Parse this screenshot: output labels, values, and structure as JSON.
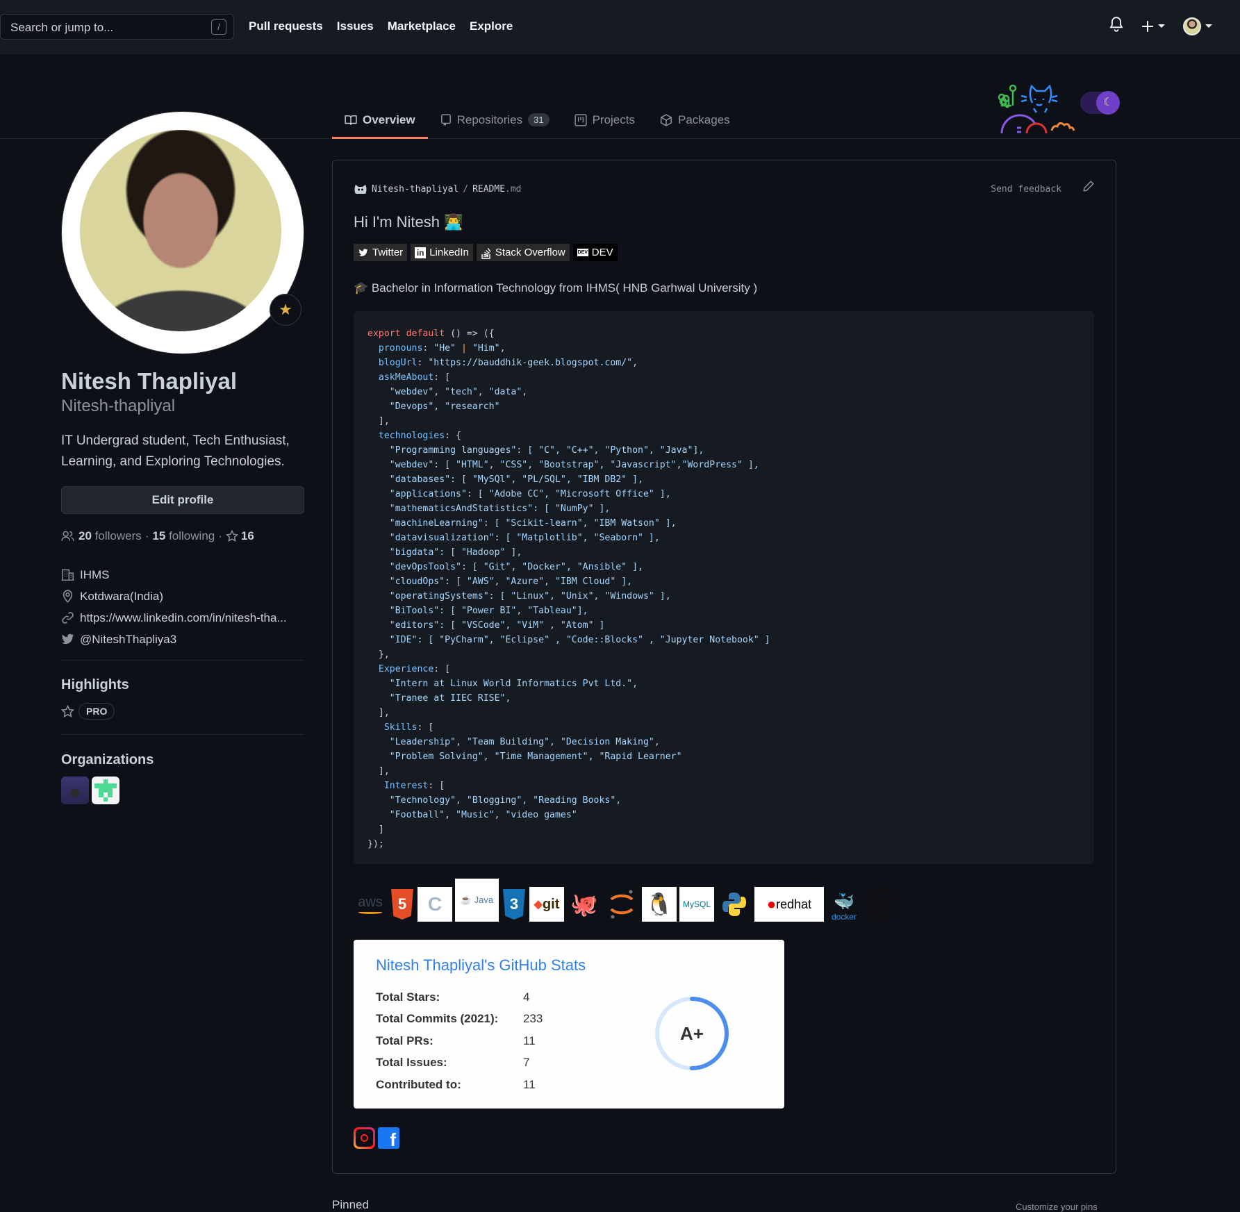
{
  "header": {
    "search_placeholder": "Search or jump to...",
    "search_shortcut": "/",
    "nav": [
      "Pull requests",
      "Issues",
      "Marketplace",
      "Explore"
    ],
    "icons": [
      "bell-icon",
      "plus-icon",
      "avatar"
    ]
  },
  "tabs": [
    {
      "label": "Overview",
      "icon": "book-icon",
      "active": true
    },
    {
      "label": "Repositories",
      "icon": "repo-icon",
      "count": "31"
    },
    {
      "label": "Projects",
      "icon": "project-icon"
    },
    {
      "label": "Packages",
      "icon": "package-icon"
    }
  ],
  "profile": {
    "name": "Nitesh Thapliyal",
    "login": "Nitesh-thapliyal",
    "bio": "IT Undergrad student, Tech Enthusiast, Learning, and Exploring Technologies.",
    "edit_label": "Edit profile",
    "followers": "20",
    "followers_label": "followers",
    "following": "15",
    "following_label": "following",
    "stars": "16",
    "company": "IHMS",
    "location": "Kotdwara(India)",
    "website": "https://www.linkedin.com/in/nitesh-tha...",
    "twitter": "@NiteshThapliya3",
    "highlights_title": "Highlights",
    "pro_badge": "PRO",
    "orgs_title": "Organizations"
  },
  "readme": {
    "owner": "Nitesh-thapliyal",
    "sep": "/",
    "file": "README",
    "ext": ".md",
    "feedback": "Send feedback",
    "heading": "Hi I'm Nitesh 👨‍💻",
    "badges": [
      "Twitter",
      "LinkedIn",
      "Stack Overflow",
      "DEV"
    ],
    "education": "🎓 Bachelor in Information Technology from IHMS( HNB Garhwal University )",
    "tech_icons": [
      "aws",
      "HTML5",
      "C",
      "Java",
      "CSS3",
      "git",
      "GitHub",
      "Jupyter",
      "Linux",
      "MySQL",
      "Python",
      "redhat",
      "docker",
      "WordPress"
    ]
  },
  "code_lines": [
    [
      [
        "k",
        "export default "
      ],
      [
        "",
        "() => ({"
      ]
    ],
    [
      [
        "p",
        "  pronouns"
      ],
      [
        "",
        ": "
      ],
      [
        "s",
        "\"He\""
      ],
      [
        "o",
        " | "
      ],
      [
        "s",
        "\"Him\""
      ],
      [
        "",
        ","
      ]
    ],
    [
      [
        "p",
        "  blogUrl"
      ],
      [
        "",
        ": "
      ],
      [
        "s",
        "\"https://bauddhik-geek.blogspot.com/\""
      ],
      [
        "",
        ","
      ]
    ],
    [
      [
        "p",
        "  askMeAbout"
      ],
      [
        "",
        ": ["
      ]
    ],
    [
      [
        "s",
        "    \"webdev\", \"tech\", \"data\","
      ]
    ],
    [
      [
        "s",
        "    \"Devops\", \"research\""
      ]
    ],
    [
      [
        "",
        "  ],"
      ]
    ],
    [
      [
        "p",
        "  technologies"
      ],
      [
        "",
        ": {"
      ]
    ],
    [
      [
        "s",
        "    \"Programming languages\": [ \"C\", \"C++\", \"Python\", \"Java\"],"
      ]
    ],
    [
      [
        "s",
        "    \"webdev\": [ \"HTML\", \"CSS\", \"Bootstrap\", \"Javascript\",\"WordPress\" ],"
      ]
    ],
    [
      [
        "s",
        "    \"databases\": [ \"MySQl\", \"PL/SQL\", \"IBM DB2\" ],"
      ]
    ],
    [
      [
        "s",
        "    \"applications\": [ \"Adobe CC\", \"Microsoft Office\" ],"
      ]
    ],
    [
      [
        "s",
        "    \"mathematicsAndStatistics\": [ \"NumPy\" ],"
      ]
    ],
    [
      [
        "s",
        "    \"machineLearning\": [ \"Scikit-learn\", \"IBM Watson\" ],"
      ]
    ],
    [
      [
        "s",
        "    \"datavisualization\": [ \"Matplotlib\", \"Seaborn\" ],"
      ]
    ],
    [
      [
        "s",
        "    \"bigdata\": [ \"Hadoop\" ],"
      ]
    ],
    [
      [
        "s",
        "    \"devOpsTools\": [ \"Git\", \"Docker\", \"Ansible\" ],"
      ]
    ],
    [
      [
        "s",
        "    \"cloudOps\": [ \"AWS\", \"Azure\", \"IBM Cloud\" ],"
      ]
    ],
    [
      [
        "s",
        "    \"operatingSystems\": [ \"Linux\", \"Unix\", \"Windows\" ],"
      ]
    ],
    [
      [
        "s",
        "    \"BiTools\": [ \"Power BI\", \"Tableau\"],"
      ]
    ],
    [
      [
        "s",
        "    \"editors\": [ \"VSCode\", \"ViM\" , \"Atom\" ]"
      ]
    ],
    [
      [
        "s",
        "    \"IDE\": [ \"PyCharm\", \"Eclipse\" , \"Code::Blocks\" , \"Jupyter Notebook\" ]"
      ]
    ],
    [
      [
        "",
        "  },"
      ]
    ],
    [
      [
        "p",
        "  Experience"
      ],
      [
        "",
        ": ["
      ]
    ],
    [
      [
        "s",
        "    \"Intern at Linux World Informatics Pvt Ltd.\","
      ]
    ],
    [
      [
        "s",
        "    \"Tranee at IIEC RISE\","
      ]
    ],
    [
      [
        "",
        "  ],"
      ]
    ],
    [
      [
        "p",
        "   Skills"
      ],
      [
        "",
        ": ["
      ]
    ],
    [
      [
        "s",
        "    \"Leadership\", \"Team Building\", \"Decision Making\","
      ]
    ],
    [
      [
        "s",
        "    \"Problem Solving\", \"Time Management\", \"Rapid Learner\""
      ]
    ],
    [
      [
        "",
        "  ],"
      ]
    ],
    [
      [
        "p",
        "   Interest"
      ],
      [
        "",
        ": ["
      ]
    ],
    [
      [
        "s",
        "    \"Technology\", \"Blogging\", \"Reading Books\","
      ]
    ],
    [
      [
        "s",
        "    \"Football\", \"Music\", \"video games\""
      ]
    ],
    [
      [
        "",
        "  ]"
      ]
    ],
    [
      [
        "",
        "});"
      ]
    ]
  ],
  "stats": {
    "title": "Nitesh Thapliyal's GitHub Stats",
    "rows": [
      {
        "label": "Total Stars:",
        "value": "4"
      },
      {
        "label": "Total Commits (2021):",
        "value": "233"
      },
      {
        "label": "Total PRs:",
        "value": "11"
      },
      {
        "label": "Total Issues:",
        "value": "7"
      },
      {
        "label": "Contributed to:",
        "value": "11"
      }
    ],
    "rank": "A+",
    "rank_progress": 0.5
  },
  "social": [
    "instagram",
    "facebook"
  ],
  "pinned": {
    "title": "Pinned",
    "customize": "Customize your pins"
  },
  "colors": {
    "accent_tab": "#f78166",
    "stats_title": "#2f80ed",
    "ring": "#4c8eeb"
  }
}
